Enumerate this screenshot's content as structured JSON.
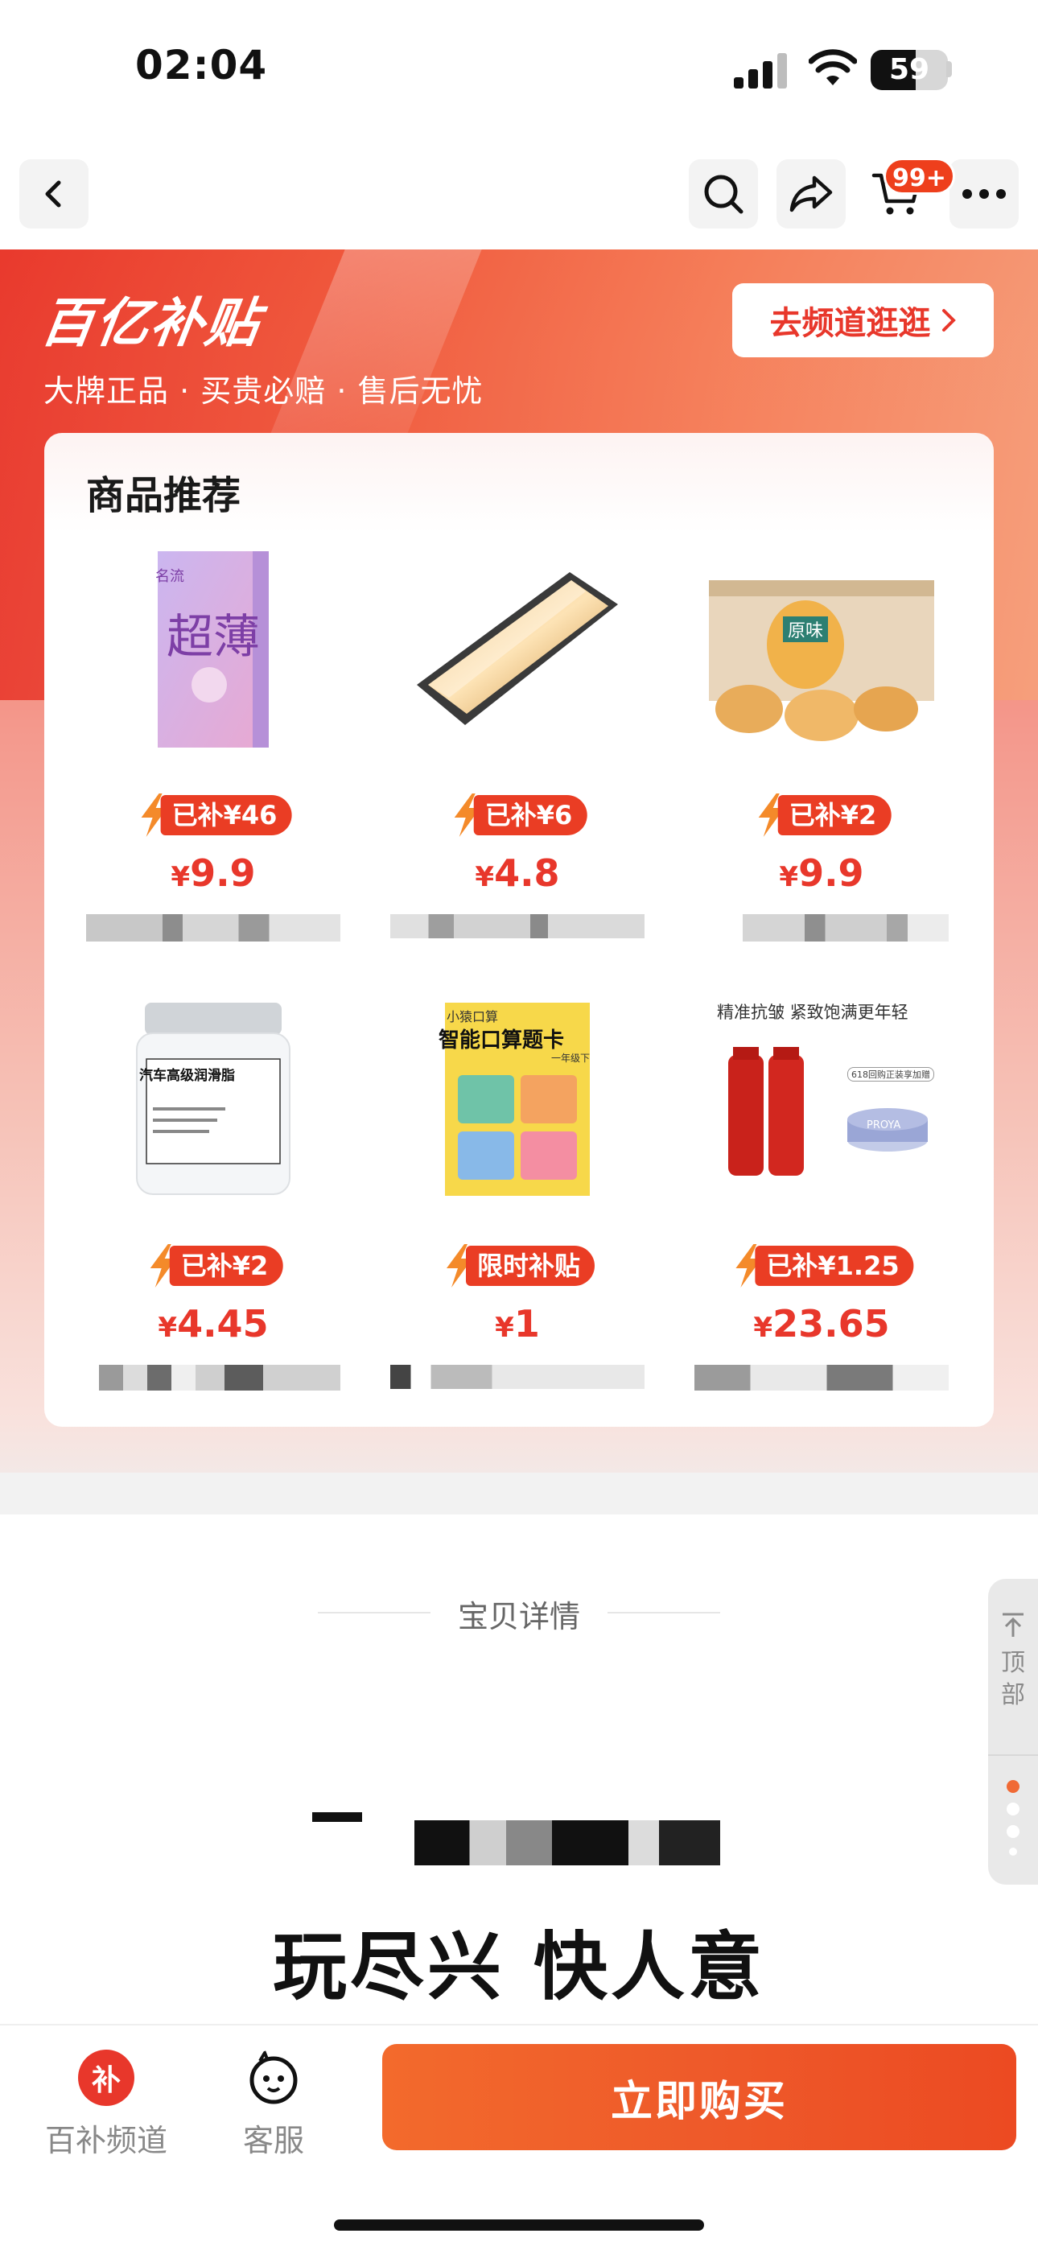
{
  "status_bar": {
    "time": "02:04",
    "battery_level": "59"
  },
  "nav": {
    "cart_badge": "99+"
  },
  "banner": {
    "logo_text": "百亿补贴",
    "subtitle": "大牌正品 · 买贵必赔 · 售后无忧",
    "channel_button": "去频道逛逛"
  },
  "recommend": {
    "title": "商品推荐",
    "products": [
      {
        "tag": "已补¥46",
        "currency": "¥",
        "price": "9.9"
      },
      {
        "tag": "已补¥6",
        "currency": "¥",
        "price": "4.8"
      },
      {
        "tag": "已补¥2",
        "currency": "¥",
        "price": "9.9"
      },
      {
        "tag": "已补¥2",
        "currency": "¥",
        "price": "4.45"
      },
      {
        "tag": "限时补贴",
        "currency": "¥",
        "price": "1"
      },
      {
        "tag": "已补¥1.25",
        "currency": "¥",
        "price": "23.65"
      }
    ],
    "product_image_text": {
      "p1_line1": "超薄",
      "p1_brand": "名流",
      "p3_label": "原味",
      "p4_label": "汽车高级润滑脂",
      "p5_brand": "小猿口算",
      "p5_title": "智能口算题卡",
      "p5_sub": "一年级下",
      "p6_headline": "精准抗皱 紧致饱满更年轻",
      "p6_promo": "618回购正装享加赠",
      "p6_brand": "PROYA"
    }
  },
  "detail": {
    "section_title": "宝贝详情",
    "slogan": "玩尽兴  快人意"
  },
  "side_tool": {
    "top_label_line1": "顶",
    "top_label_line2": "部"
  },
  "bottom_bar": {
    "channel_icon_text": "补",
    "channel_label": "百补频道",
    "service_label": "客服",
    "buy_label": "立即购买"
  },
  "colors": {
    "accent_red": "#e8372b",
    "buy_orange": "#ee5a2a"
  }
}
